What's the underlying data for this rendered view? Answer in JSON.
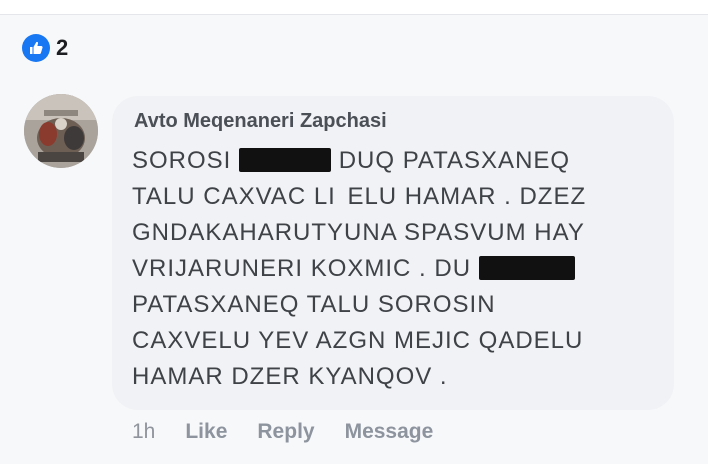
{
  "reactions": {
    "count": "2",
    "icon": "like-thumbs-up-icon",
    "color": "#1877f2"
  },
  "comment": {
    "author": "Avto Meqenaneri Zapchasi",
    "lines": [
      {
        "before": "SOROSI ",
        "after": " DUQ PATASXANEQ"
      },
      {
        "text": "TALU CAXVAC LI  ELU HAMAR . DZEZ"
      },
      {
        "text": "GNDAKAHARUTYUNA SPASVUM HAY"
      },
      {
        "before": "VRIJARUNERI KOXMIC . DU ",
        "after": ""
      },
      {
        "text": "PATASXANEQ TALU SOROSIN"
      },
      {
        "text": "CAXVELU YEV AZGN MEJIC QADELU"
      },
      {
        "text": "HAMAR DZER KYANQOV ."
      }
    ]
  },
  "actions": {
    "time": "1h",
    "like": "Like",
    "reply": "Reply",
    "message": "Message"
  }
}
